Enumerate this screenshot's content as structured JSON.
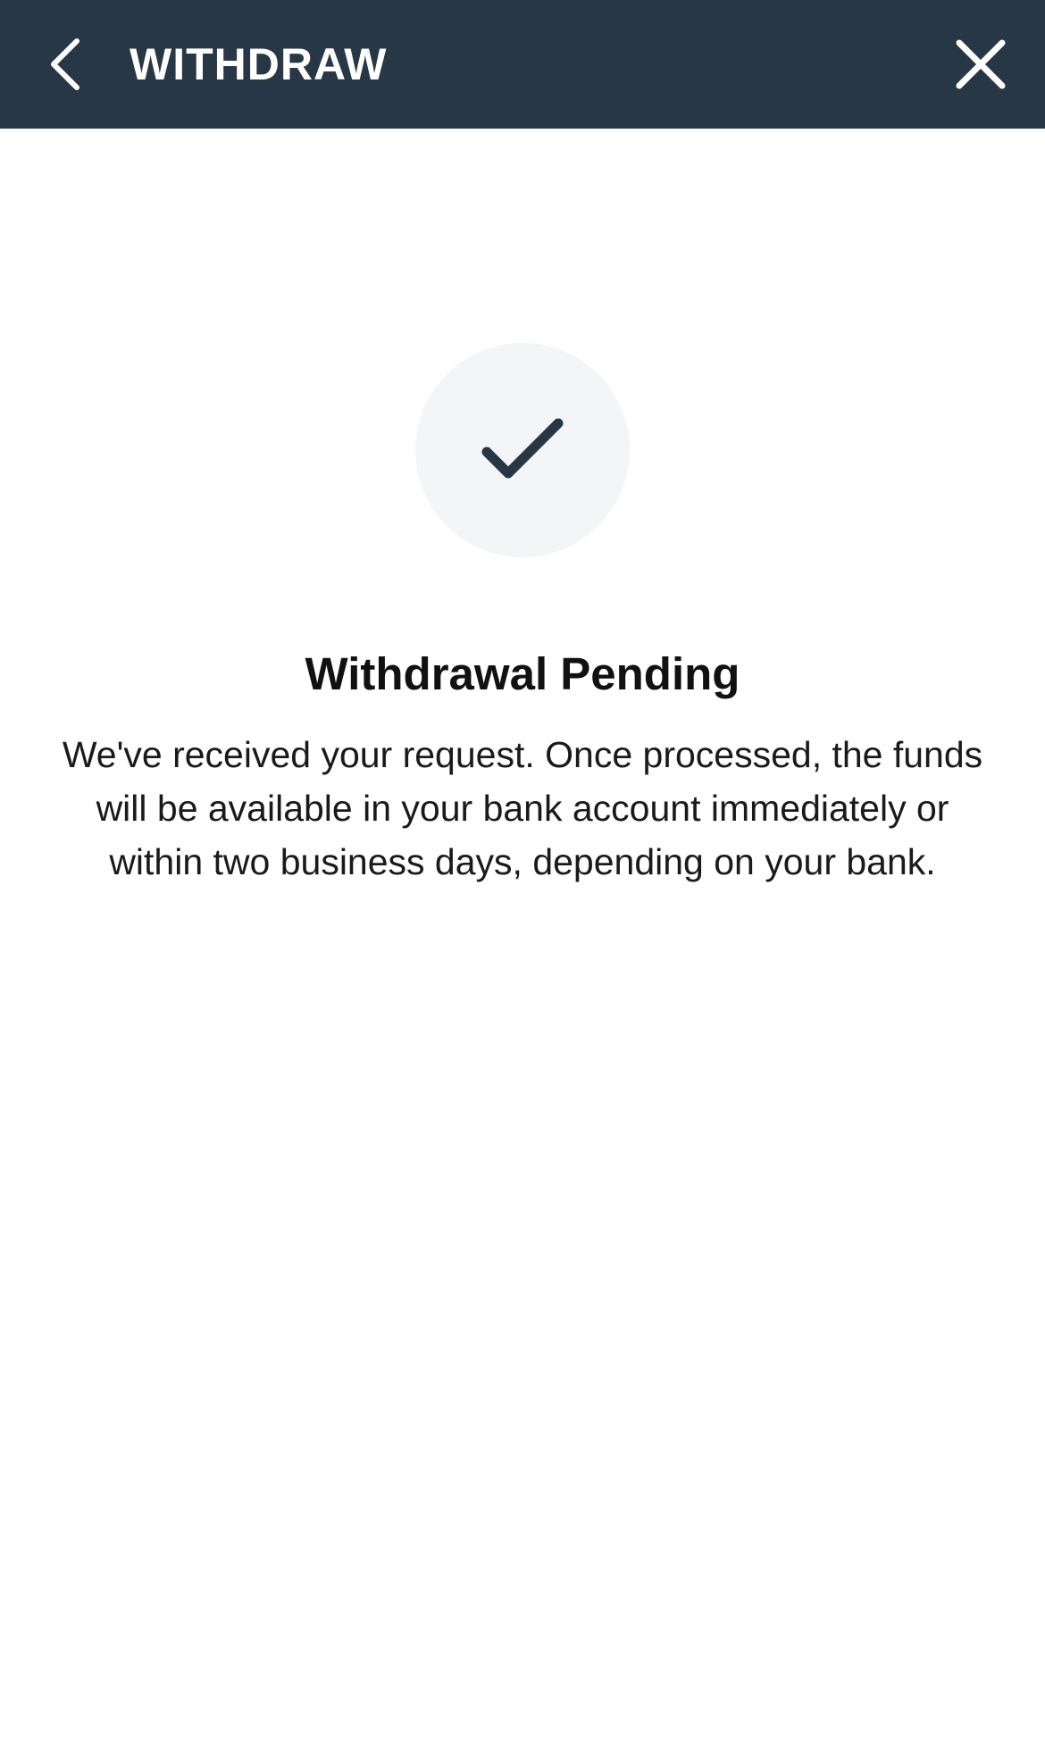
{
  "header": {
    "title": "WITHDRAW",
    "back_icon": "chevron-left-icon",
    "close_icon": "close-icon",
    "background_color": "#283746"
  },
  "status": {
    "icon": "checkmark-icon",
    "title": "Withdrawal Pending",
    "message": "We've received your request. Once processed, the funds will be available in your bank account immediately or within two business days, depending on your bank."
  },
  "colors": {
    "accent": "#283746",
    "circle_bg": "#f3f5f7"
  }
}
